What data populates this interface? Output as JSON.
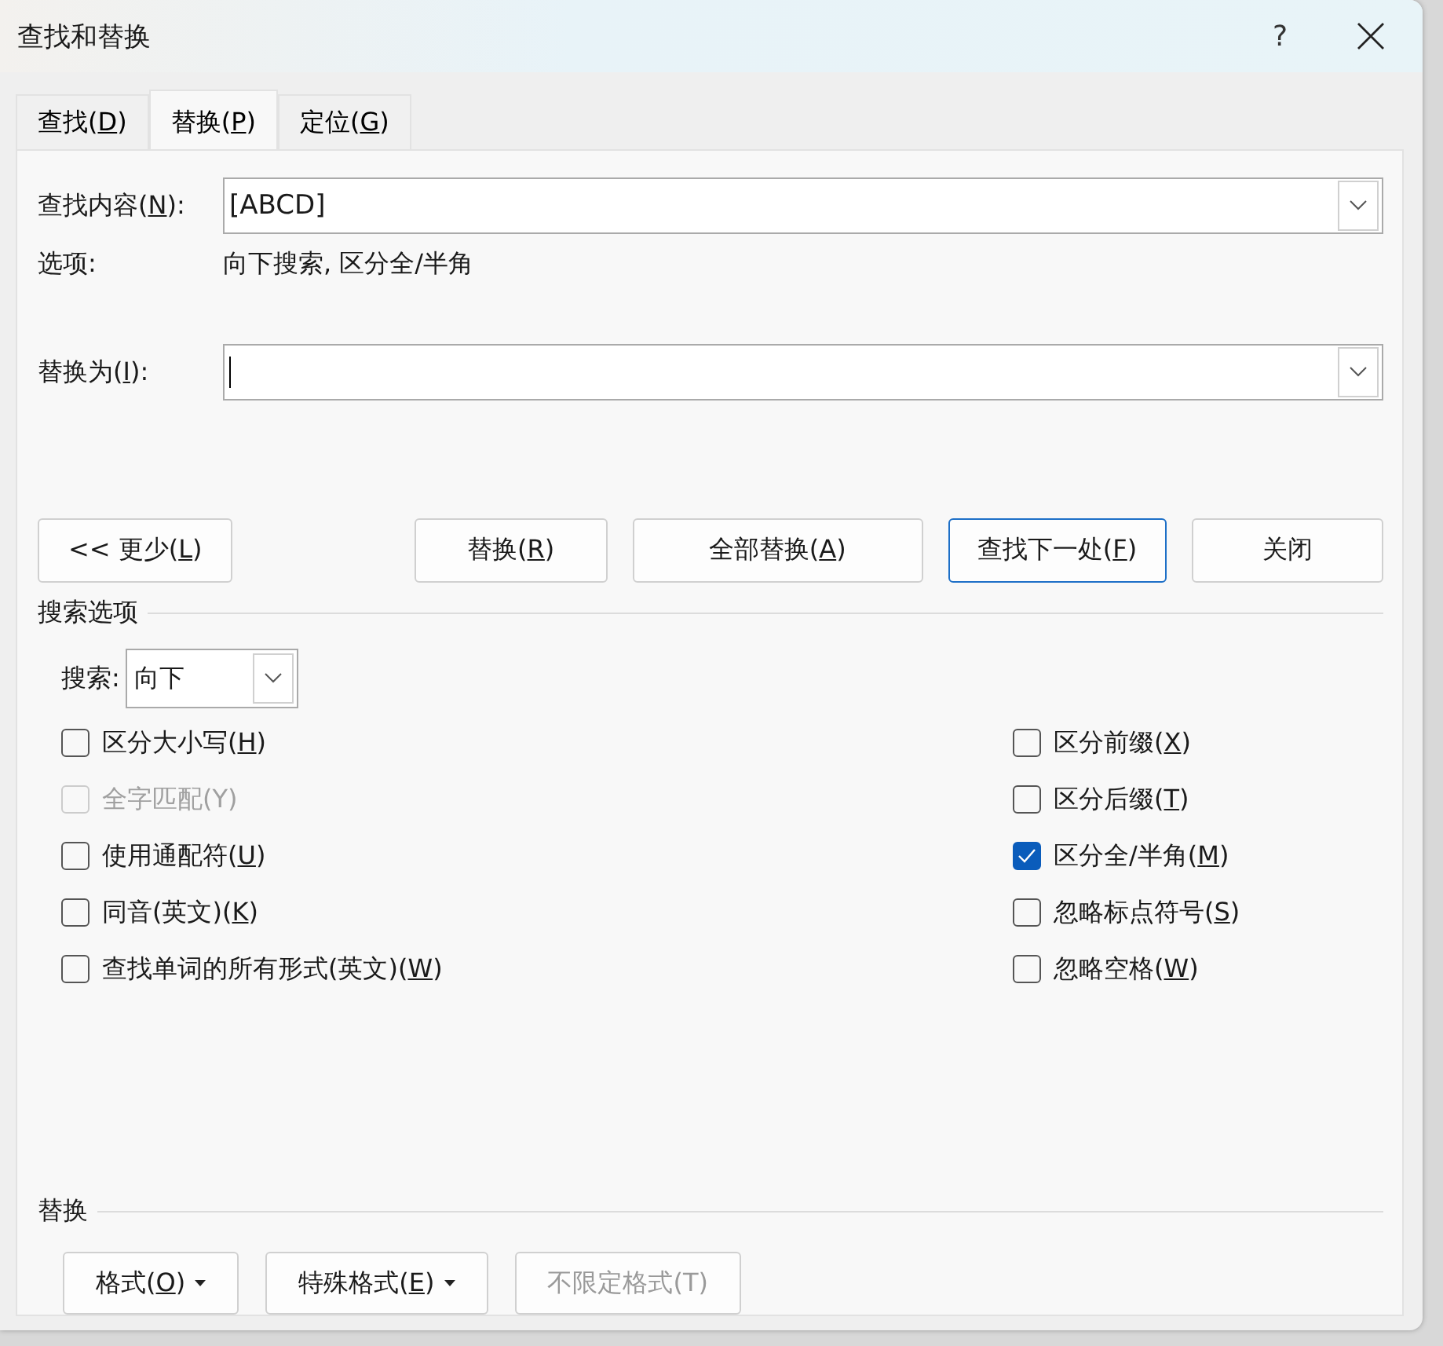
{
  "window": {
    "title": "查找和替换",
    "help": "?"
  },
  "tabs": [
    {
      "label": {
        "text": "查找(",
        "key": "D",
        "tail": ")"
      },
      "selected": false
    },
    {
      "label": {
        "text": "替换(",
        "key": "P",
        "tail": ")"
      },
      "selected": true
    },
    {
      "label": {
        "text": "定位(",
        "key": "G",
        "tail": ")"
      },
      "selected": false
    }
  ],
  "find": {
    "label": {
      "text": "查找内容(",
      "key": "N",
      "tail": "):"
    },
    "value": "[ABCD]"
  },
  "options": {
    "label": "选项:",
    "value": "向下搜索, 区分全/半角"
  },
  "replace": {
    "label": {
      "text": "替换为(",
      "key": "I",
      "tail": "):"
    },
    "focused": true
  },
  "buttons": [
    {
      "label": {
        "text": "<< 更少(",
        "key": "L",
        "tail": ")"
      },
      "default": false
    },
    {
      "label": {
        "text": "替换(",
        "key": "R",
        "tail": ")"
      },
      "default": false
    },
    {
      "label": {
        "text": "全部替换(",
        "key": "A",
        "tail": ")"
      },
      "default": false
    },
    {
      "label": {
        "text": "查找下一处(",
        "key": "F",
        "tail": ")"
      },
      "default": true
    },
    {
      "label": {
        "text": "关闭"
      },
      "default": false
    }
  ],
  "search_options": {
    "title": "搜索选项",
    "direction": {
      "label": "搜索:",
      "value": "向下"
    },
    "left": [
      {
        "label": {
          "text": "区分大小写(",
          "key": "H",
          "tail": ")"
        },
        "checked": false,
        "disabled": false
      },
      {
        "label": {
          "text": "全字匹配(Y)"
        },
        "checked": false,
        "disabled": true
      },
      {
        "label": {
          "text": "使用通配符(",
          "key": "U",
          "tail": ")"
        },
        "checked": false,
        "disabled": false
      },
      {
        "label": {
          "text": "同音(英文)(",
          "key": "K",
          "tail": ")"
        },
        "checked": false,
        "disabled": false
      },
      {
        "label": {
          "text": "查找单词的所有形式(英文)(",
          "key": "W",
          "tail": ")"
        },
        "checked": false,
        "disabled": false
      }
    ],
    "right": [
      {
        "label": {
          "text": "区分前缀(",
          "key": "X",
          "tail": ")"
        },
        "checked": false,
        "disabled": false
      },
      {
        "label": {
          "text": "区分后缀(",
          "key": "T",
          "tail": ")"
        },
        "checked": false,
        "disabled": false
      },
      {
        "label": {
          "text": "区分全/半角(",
          "key": "M",
          "tail": ")"
        },
        "checked": true,
        "disabled": false
      },
      {
        "label": {
          "text": "忽略标点符号(",
          "key": "S",
          "tail": ")"
        },
        "checked": false,
        "disabled": false
      },
      {
        "label": {
          "text": "忽略空格(",
          "key": "W",
          "tail": ")"
        },
        "checked": false,
        "disabled": false
      }
    ]
  },
  "replace_section": {
    "title": "替换",
    "buttons": [
      {
        "label": {
          "text": "格式(",
          "key": "O",
          "tail": ")"
        },
        "dropdown": true,
        "disabled": false
      },
      {
        "label": {
          "text": "特殊格式(",
          "key": "E",
          "tail": ")"
        },
        "dropdown": true,
        "disabled": false
      },
      {
        "label": {
          "text": "不限定格式(T)"
        },
        "dropdown": false,
        "disabled": true
      }
    ]
  }
}
